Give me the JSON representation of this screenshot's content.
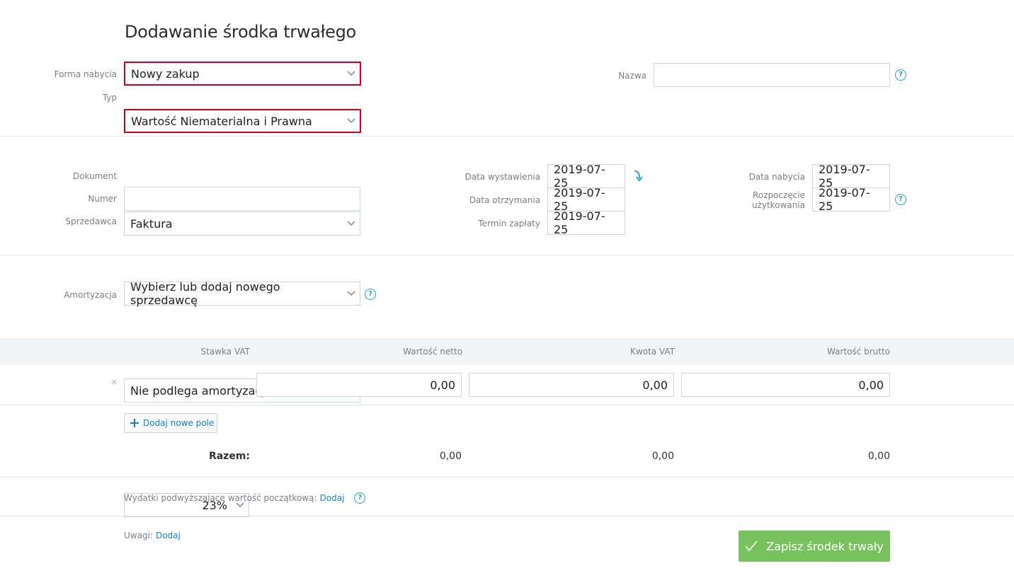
{
  "page": {
    "title": "Dodawanie środka trwałego"
  },
  "acquisition": {
    "forma_label": "Forma nabycia",
    "forma_value": "Nowy zakup",
    "typ_label": "Typ",
    "typ_value": "Wartość Niematerialna i Prawna",
    "nazwa_label": "Nazwa",
    "nazwa_value": ""
  },
  "document": {
    "dokument_label": "Dokument",
    "dokument_value": "Faktura",
    "numer_label": "Numer",
    "numer_value": "",
    "sprzedawca_label": "Sprzedawca",
    "sprzedawca_value": "Wybierz lub dodaj nowego sprzedawcę"
  },
  "dates": {
    "wystawienia_label": "Data wystawienia",
    "wystawienia_value": "2019-07-25",
    "otrzymania_label": "Data otrzymania",
    "otrzymania_value": "2019-07-25",
    "termin_label": "Termin zapłaty",
    "termin_value": "2019-07-25",
    "nabycia_label": "Data nabycia",
    "nabycia_value": "2019-07-25",
    "rozpoczecie_label_line1": "Rozpoczęcie",
    "rozpoczecie_label_line2": "użytkowania",
    "rozpoczecie_value": "2019-07-25"
  },
  "amortization": {
    "label": "Amortyzacja",
    "value": "Nie podlega amortyzacji"
  },
  "vat_table": {
    "headers": {
      "stawka": "Stawka VAT",
      "netto": "Wartość netto",
      "kwota": "Kwota VAT",
      "brutto": "Wartość brutto"
    },
    "row": {
      "remove": "×",
      "stawka": "23%",
      "netto": "0,00",
      "kwota": "0,00",
      "brutto": "0,00"
    },
    "add_button": "Dodaj nowe pole",
    "sum_label": "Razem:",
    "sum": {
      "netto": "0,00",
      "kwota": "0,00",
      "brutto": "0,00"
    }
  },
  "extras": {
    "wydatki_label": "Wydatki podwyższające wartość początkową:",
    "wydatki_link": "Dodaj",
    "uwagi_label": "Uwagi:",
    "uwagi_link": "Dodaj"
  },
  "actions": {
    "save": "Zapisz środek trwały"
  },
  "help_glyph": "?",
  "colors": {
    "accent": "#1a82c3",
    "error": "#d0021b",
    "success": "#78c25d"
  }
}
